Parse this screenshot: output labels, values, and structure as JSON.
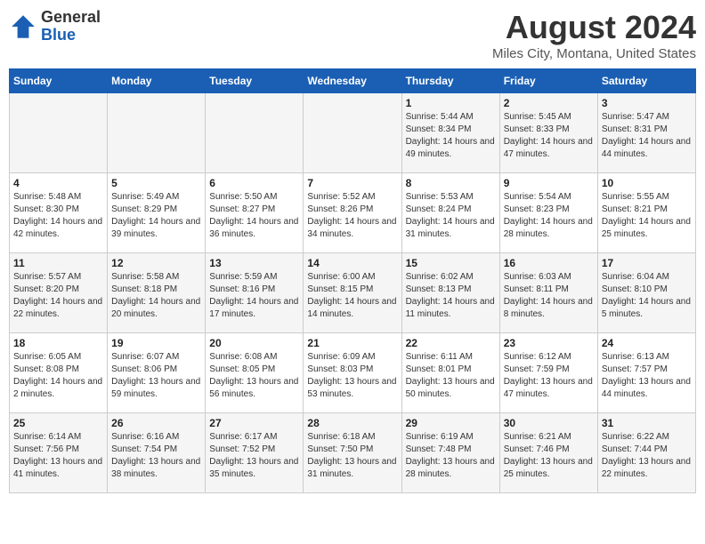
{
  "logo": {
    "general": "General",
    "blue": "Blue"
  },
  "title": "August 2024",
  "subtitle": "Miles City, Montana, United States",
  "days_of_week": [
    "Sunday",
    "Monday",
    "Tuesday",
    "Wednesday",
    "Thursday",
    "Friday",
    "Saturday"
  ],
  "weeks": [
    [
      {
        "day": "",
        "info": ""
      },
      {
        "day": "",
        "info": ""
      },
      {
        "day": "",
        "info": ""
      },
      {
        "day": "",
        "info": ""
      },
      {
        "day": "1",
        "info": "Sunrise: 5:44 AM\nSunset: 8:34 PM\nDaylight: 14 hours and 49 minutes."
      },
      {
        "day": "2",
        "info": "Sunrise: 5:45 AM\nSunset: 8:33 PM\nDaylight: 14 hours and 47 minutes."
      },
      {
        "day": "3",
        "info": "Sunrise: 5:47 AM\nSunset: 8:31 PM\nDaylight: 14 hours and 44 minutes."
      }
    ],
    [
      {
        "day": "4",
        "info": "Sunrise: 5:48 AM\nSunset: 8:30 PM\nDaylight: 14 hours and 42 minutes."
      },
      {
        "day": "5",
        "info": "Sunrise: 5:49 AM\nSunset: 8:29 PM\nDaylight: 14 hours and 39 minutes."
      },
      {
        "day": "6",
        "info": "Sunrise: 5:50 AM\nSunset: 8:27 PM\nDaylight: 14 hours and 36 minutes."
      },
      {
        "day": "7",
        "info": "Sunrise: 5:52 AM\nSunset: 8:26 PM\nDaylight: 14 hours and 34 minutes."
      },
      {
        "day": "8",
        "info": "Sunrise: 5:53 AM\nSunset: 8:24 PM\nDaylight: 14 hours and 31 minutes."
      },
      {
        "day": "9",
        "info": "Sunrise: 5:54 AM\nSunset: 8:23 PM\nDaylight: 14 hours and 28 minutes."
      },
      {
        "day": "10",
        "info": "Sunrise: 5:55 AM\nSunset: 8:21 PM\nDaylight: 14 hours and 25 minutes."
      }
    ],
    [
      {
        "day": "11",
        "info": "Sunrise: 5:57 AM\nSunset: 8:20 PM\nDaylight: 14 hours and 22 minutes."
      },
      {
        "day": "12",
        "info": "Sunrise: 5:58 AM\nSunset: 8:18 PM\nDaylight: 14 hours and 20 minutes."
      },
      {
        "day": "13",
        "info": "Sunrise: 5:59 AM\nSunset: 8:16 PM\nDaylight: 14 hours and 17 minutes."
      },
      {
        "day": "14",
        "info": "Sunrise: 6:00 AM\nSunset: 8:15 PM\nDaylight: 14 hours and 14 minutes."
      },
      {
        "day": "15",
        "info": "Sunrise: 6:02 AM\nSunset: 8:13 PM\nDaylight: 14 hours and 11 minutes."
      },
      {
        "day": "16",
        "info": "Sunrise: 6:03 AM\nSunset: 8:11 PM\nDaylight: 14 hours and 8 minutes."
      },
      {
        "day": "17",
        "info": "Sunrise: 6:04 AM\nSunset: 8:10 PM\nDaylight: 14 hours and 5 minutes."
      }
    ],
    [
      {
        "day": "18",
        "info": "Sunrise: 6:05 AM\nSunset: 8:08 PM\nDaylight: 14 hours and 2 minutes."
      },
      {
        "day": "19",
        "info": "Sunrise: 6:07 AM\nSunset: 8:06 PM\nDaylight: 13 hours and 59 minutes."
      },
      {
        "day": "20",
        "info": "Sunrise: 6:08 AM\nSunset: 8:05 PM\nDaylight: 13 hours and 56 minutes."
      },
      {
        "day": "21",
        "info": "Sunrise: 6:09 AM\nSunset: 8:03 PM\nDaylight: 13 hours and 53 minutes."
      },
      {
        "day": "22",
        "info": "Sunrise: 6:11 AM\nSunset: 8:01 PM\nDaylight: 13 hours and 50 minutes."
      },
      {
        "day": "23",
        "info": "Sunrise: 6:12 AM\nSunset: 7:59 PM\nDaylight: 13 hours and 47 minutes."
      },
      {
        "day": "24",
        "info": "Sunrise: 6:13 AM\nSunset: 7:57 PM\nDaylight: 13 hours and 44 minutes."
      }
    ],
    [
      {
        "day": "25",
        "info": "Sunrise: 6:14 AM\nSunset: 7:56 PM\nDaylight: 13 hours and 41 minutes."
      },
      {
        "day": "26",
        "info": "Sunrise: 6:16 AM\nSunset: 7:54 PM\nDaylight: 13 hours and 38 minutes."
      },
      {
        "day": "27",
        "info": "Sunrise: 6:17 AM\nSunset: 7:52 PM\nDaylight: 13 hours and 35 minutes."
      },
      {
        "day": "28",
        "info": "Sunrise: 6:18 AM\nSunset: 7:50 PM\nDaylight: 13 hours and 31 minutes."
      },
      {
        "day": "29",
        "info": "Sunrise: 6:19 AM\nSunset: 7:48 PM\nDaylight: 13 hours and 28 minutes."
      },
      {
        "day": "30",
        "info": "Sunrise: 6:21 AM\nSunset: 7:46 PM\nDaylight: 13 hours and 25 minutes."
      },
      {
        "day": "31",
        "info": "Sunrise: 6:22 AM\nSunset: 7:44 PM\nDaylight: 13 hours and 22 minutes."
      }
    ]
  ]
}
